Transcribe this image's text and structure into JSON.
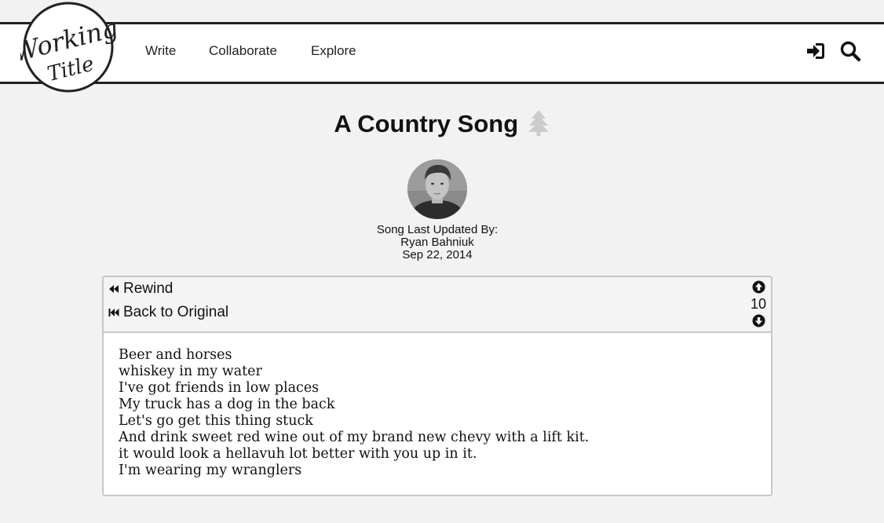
{
  "header": {
    "logo_text": "Working Title",
    "nav": {
      "write": "Write",
      "collaborate": "Collaborate",
      "explore": "Explore"
    },
    "icons": [
      "sign-in-icon",
      "search-icon"
    ]
  },
  "song": {
    "title": "A Country Song",
    "title_icon": "tree-icon",
    "updated_label": "Song Last Updated By:",
    "author": "Ryan Bahniuk",
    "date": "Sep 22, 2014"
  },
  "panel": {
    "rewind_label": "Rewind",
    "back_label": "Back to Original",
    "votes": "10",
    "lyrics": [
      "Beer and horses",
      "whiskey in my water",
      "I've got friends in low places",
      "My truck has a dog in the back",
      "Let's go get this thing stuck",
      "And drink sweet red wine out of my brand new chevy with a lift kit.",
      "it would look a hellavuh lot better with you up in it.",
      "I'm wearing my wranglers"
    ]
  },
  "colors": {
    "background": "#f2f2f2",
    "nav_border": "#222222",
    "panel_border": "#c7c7c7",
    "tree_icon": "#cccccc"
  }
}
